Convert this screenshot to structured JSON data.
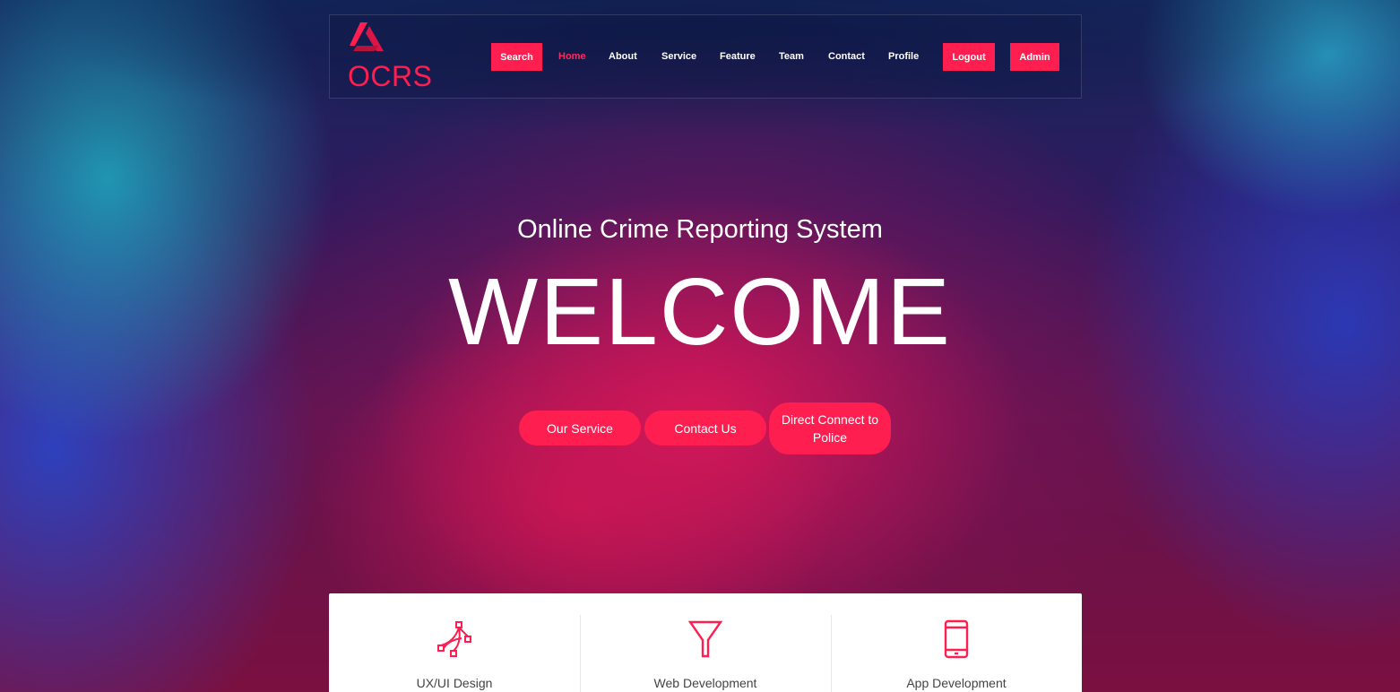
{
  "brand": {
    "name": "OCRS",
    "accent_color": "#ff1e50",
    "logo_icon": "triangle-logo-icon"
  },
  "nav": {
    "search": "Search",
    "home": "Home",
    "about": "About",
    "service": "Service",
    "feature": "Feature",
    "team": "Team",
    "contact": "Contact",
    "profile": "Profile",
    "logout": "Logout",
    "admin": "Admin"
  },
  "hero": {
    "subtitle": "Online Crime Reporting System",
    "title": "WELCOME",
    "buttons": {
      "our_service": "Our Service",
      "contact_us": "Contact Us",
      "direct_connect": "Direct Connect to Police"
    }
  },
  "services": [
    {
      "label": "UX/UI Design",
      "icon": "vector-pen-icon"
    },
    {
      "label": "Web Development",
      "icon": "funnel-icon"
    },
    {
      "label": "App Development",
      "icon": "mobile-phone-icon"
    }
  ]
}
